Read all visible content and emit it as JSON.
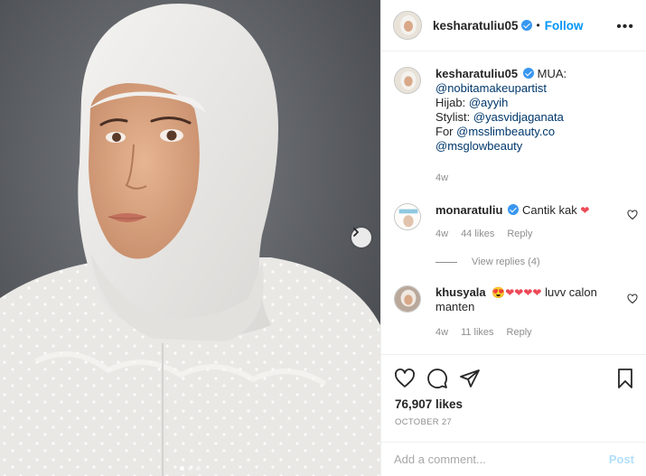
{
  "post": {
    "image_alt": "Portrait of a woman wearing a white hijab and white lace top",
    "carousel_dots": 3,
    "carousel_active": 0
  },
  "header": {
    "username": "kesharatuliu05",
    "separator": "•",
    "follow_label": "Follow",
    "more_label": "•••"
  },
  "caption": {
    "username": "kesharatuliu05",
    "lines": [
      {
        "text": "MUA:",
        "mention": ""
      },
      {
        "text": "",
        "mention": "@nobitamakeupartist"
      },
      {
        "text": "Hijab: ",
        "mention": "@ayyih"
      },
      {
        "text": "Stylist: ",
        "mention": "@yasvidjaganata"
      },
      {
        "text": "For ",
        "mention": "@msslimbeauty.co"
      },
      {
        "text": "",
        "mention": "@msglowbeauty"
      }
    ],
    "time": "4w"
  },
  "comments": [
    {
      "username": "monaratuliu",
      "text": "Cantik kak",
      "emoji": "❤",
      "time": "4w",
      "likes": "44 likes",
      "reply_label": "Reply",
      "view_replies": "View replies (4)"
    },
    {
      "username": "khusyala",
      "emoji": "😍❤❤❤❤",
      "text": "luvv calon manten",
      "time": "4w",
      "likes": "11 likes",
      "reply_label": "Reply"
    }
  ],
  "actions": {
    "icons": [
      "heart-icon",
      "comment-icon",
      "share-icon",
      "bookmark-icon"
    ]
  },
  "likes_count": "76,907 likes",
  "date": "OCTOBER 27",
  "add_comment": {
    "placeholder": "Add a comment...",
    "post_label": "Post"
  },
  "colors": {
    "accent": "#0095f6",
    "verified": "#3897f0",
    "heart_red": "#ed4956",
    "muted": "#8e8e8e"
  }
}
